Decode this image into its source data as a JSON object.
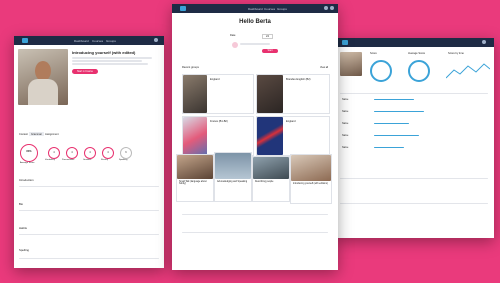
{
  "left": {
    "title": "Introducing yourself (with edited)",
    "button": "Start in Course",
    "tabs": [
      "Context",
      "Grammar",
      "Assignment"
    ],
    "score": "80%",
    "score_label": "Average Score",
    "rings": [
      {
        "value": "4",
        "label": "Vocabulary"
      },
      {
        "value": "4",
        "label": "Pronunciation"
      },
      {
        "value": "4",
        "label": "Grammar"
      },
      {
        "value": "4",
        "label": "Fluency"
      },
      {
        "value": "6",
        "label": "Speaking"
      }
    ],
    "sections": [
      "Introduction",
      "Bio",
      "Habits",
      "Spelling"
    ]
  },
  "center": {
    "nav_links": [
      "Dashboard",
      "Courses",
      "Groups"
    ],
    "greeting": "Hello Berta",
    "date_label": "Date",
    "stepper_value": "24",
    "start_button": "Start",
    "recent": "Recent groups",
    "view_all": "View all",
    "groups": [
      "England",
      "Brandes English (B2)",
      "France (B1-B2)",
      "England"
    ],
    "lessons": [
      "Small Talk (language about hobby)",
      "Acknowledging and Speaking",
      "Describing people",
      "Introducing yourself (with editions)"
    ]
  },
  "right": {
    "stats": [
      "Score",
      "Average Score",
      "Score by time"
    ],
    "rows": [
      "Name",
      "Name",
      "Name",
      "Name",
      "Name"
    ]
  }
}
